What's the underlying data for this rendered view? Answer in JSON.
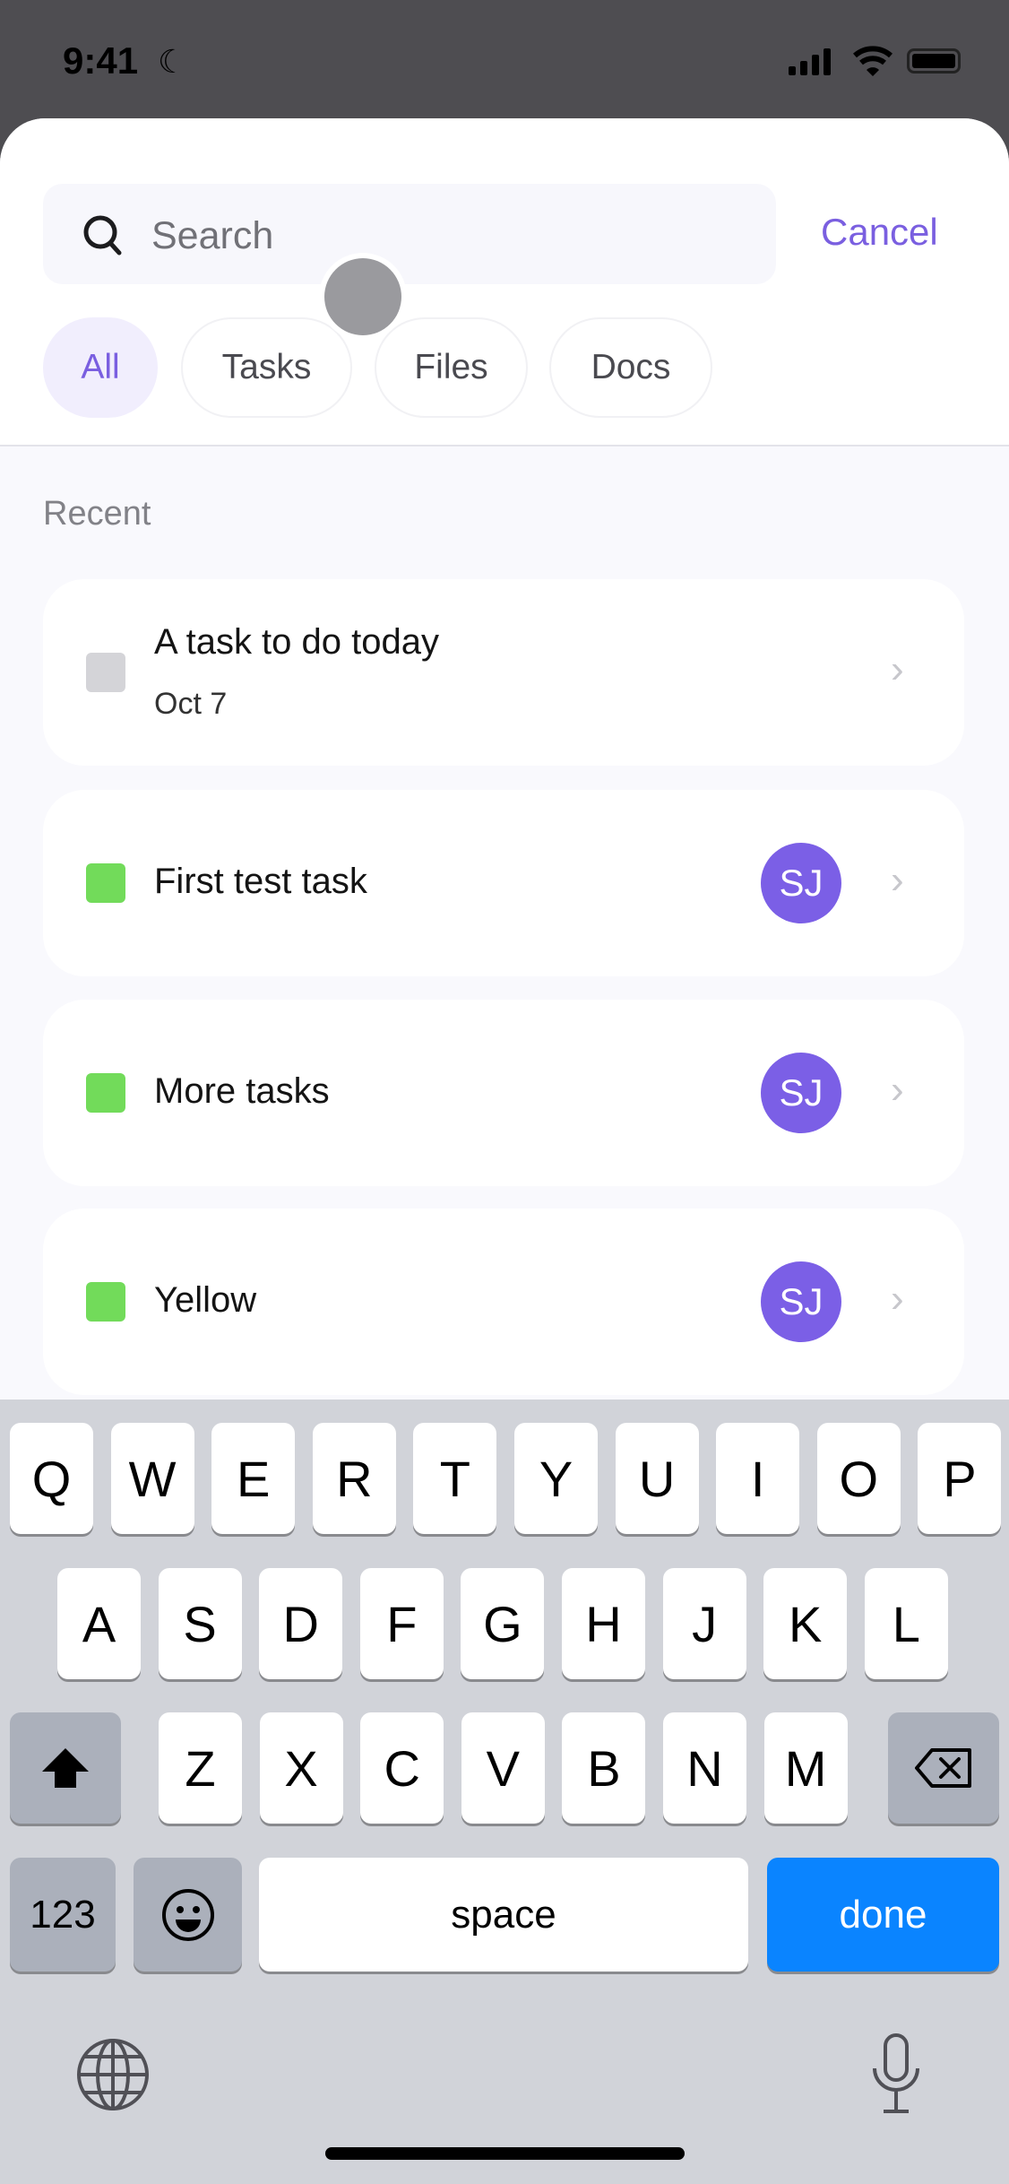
{
  "status_bar": {
    "time": "9:41"
  },
  "search": {
    "placeholder": "Search",
    "cancel_label": "Cancel"
  },
  "filters": [
    {
      "label": "All",
      "active": true
    },
    {
      "label": "Tasks"
    },
    {
      "label": "Files"
    },
    {
      "label": "Docs"
    }
  ],
  "section_title": "Recent",
  "items": [
    {
      "title": "A task to do today",
      "subtitle": "Oct 7",
      "color": "#d4d4d8",
      "assignee": ""
    },
    {
      "title": "First test task",
      "color": "#72db5a",
      "assignee": "SJ"
    },
    {
      "title": "More tasks",
      "color": "#72db5a",
      "assignee": "SJ"
    },
    {
      "title": "Yellow",
      "color": "#72db5a",
      "assignee": "SJ"
    }
  ],
  "keyboard": {
    "row1": [
      "Q",
      "W",
      "E",
      "R",
      "T",
      "Y",
      "U",
      "I",
      "O",
      "P"
    ],
    "row2": [
      "A",
      "S",
      "D",
      "F",
      "G",
      "H",
      "J",
      "K",
      "L"
    ],
    "row3": [
      "Z",
      "X",
      "C",
      "V",
      "B",
      "N",
      "M"
    ],
    "numbers_label": "123",
    "space_label": "space",
    "done_label": "done"
  },
  "colors": {
    "accent": "#7a5fe0",
    "done": "#0a84ff",
    "avatar": "#7b5fe6"
  }
}
